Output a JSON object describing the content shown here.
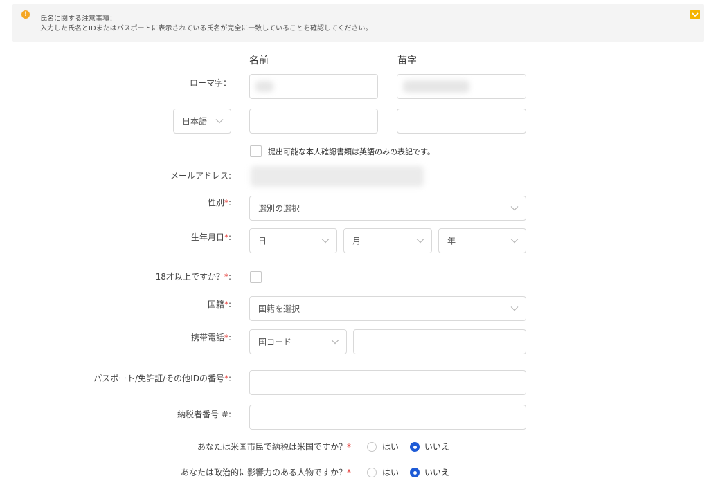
{
  "notice": {
    "title": "氏名に関する注意事項：",
    "text": "入力した氏名とIDまたはパスポートに表示されている氏名が完全に一致していることを確認してください。"
  },
  "columns": {
    "first": "名前",
    "last": "苗字"
  },
  "name": {
    "romaji_label": "ローマ字：",
    "language_select": "日本語"
  },
  "english_only_checkbox": "提出可能な本人確認書類は英語のみの表記です。",
  "email": {
    "label": "メールアドレス:"
  },
  "gender": {
    "label": "性別",
    "placeholder": "選別の選択"
  },
  "birthdate": {
    "label": "生年月日",
    "day": "日",
    "month": "月",
    "year": "年"
  },
  "adult": {
    "label": "18才以上ですか？"
  },
  "nationality": {
    "label": "国籍",
    "placeholder": "国籍を選択"
  },
  "mobile": {
    "label": "携帯電話",
    "country_code": "国コード"
  },
  "id_number": {
    "label": "パスポート/免許証/その他IDの番号"
  },
  "taxpayer": {
    "label": "納税者番号 #:"
  },
  "us_citizen": {
    "question": "あなたは米国市民で納税は米国ですか？",
    "yes": "はい",
    "no": "いいえ",
    "selected": "いいえ"
  },
  "pep": {
    "question": "あなたは政治的に影響力のある人物ですか？",
    "yes": "はい",
    "no": "いいえ",
    "selected": "いいえ"
  },
  "required_mark": "*",
  "colors": {
    "accent": "#1e5bd6",
    "required": "#e53935",
    "warning": "#f5a623"
  }
}
